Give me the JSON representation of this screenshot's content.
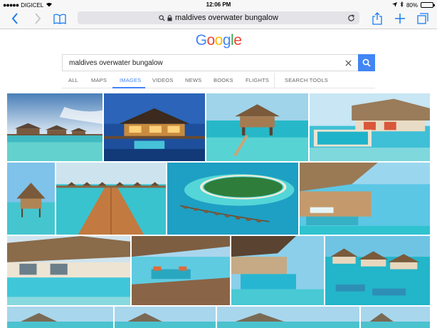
{
  "status_bar": {
    "carrier": "DIGICEL",
    "time": "12:06 PM",
    "battery": "80%",
    "battery_level": 0.8
  },
  "toolbar": {
    "address": "maldives overwater bungalow"
  },
  "logo": [
    "G",
    "o",
    "o",
    "g",
    "l",
    "e"
  ],
  "logo_colors": [
    "#4285f4",
    "#ea4335",
    "#fbbc05",
    "#4285f4",
    "#34a853",
    "#ea4335"
  ],
  "search": {
    "value": "maldives overwater bungalow"
  },
  "tabs": [
    {
      "label": "ALL",
      "active": false
    },
    {
      "label": "MAPS",
      "active": false
    },
    {
      "label": "IMAGES",
      "active": true
    },
    {
      "label": "VIDEOS",
      "active": false
    },
    {
      "label": "NEWS",
      "active": false
    },
    {
      "label": "BOOKS",
      "active": false
    },
    {
      "label": "FLIGHTS",
      "active": false
    },
    {
      "label": "SEARCH TOOLS",
      "active": false
    }
  ],
  "colors": {
    "accent": "#4285f4",
    "safari_blue": "#1a7cf2"
  },
  "results": [
    {
      "scene": "sunset-bungalows"
    },
    {
      "scene": "night-villa"
    },
    {
      "scene": "lagoon-hut"
    },
    {
      "scene": "pool-villa"
    },
    {
      "scene": "single-hut"
    },
    {
      "scene": "jetty"
    },
    {
      "scene": "aerial-island"
    },
    {
      "scene": "deck-loungers"
    },
    {
      "scene": "pool-terrace"
    },
    {
      "scene": "deck-sofa"
    },
    {
      "scene": "deck-pool"
    },
    {
      "scene": "row-villas"
    },
    {
      "scene": "partial"
    },
    {
      "scene": "partial"
    },
    {
      "scene": "partial"
    },
    {
      "scene": "partial"
    }
  ]
}
